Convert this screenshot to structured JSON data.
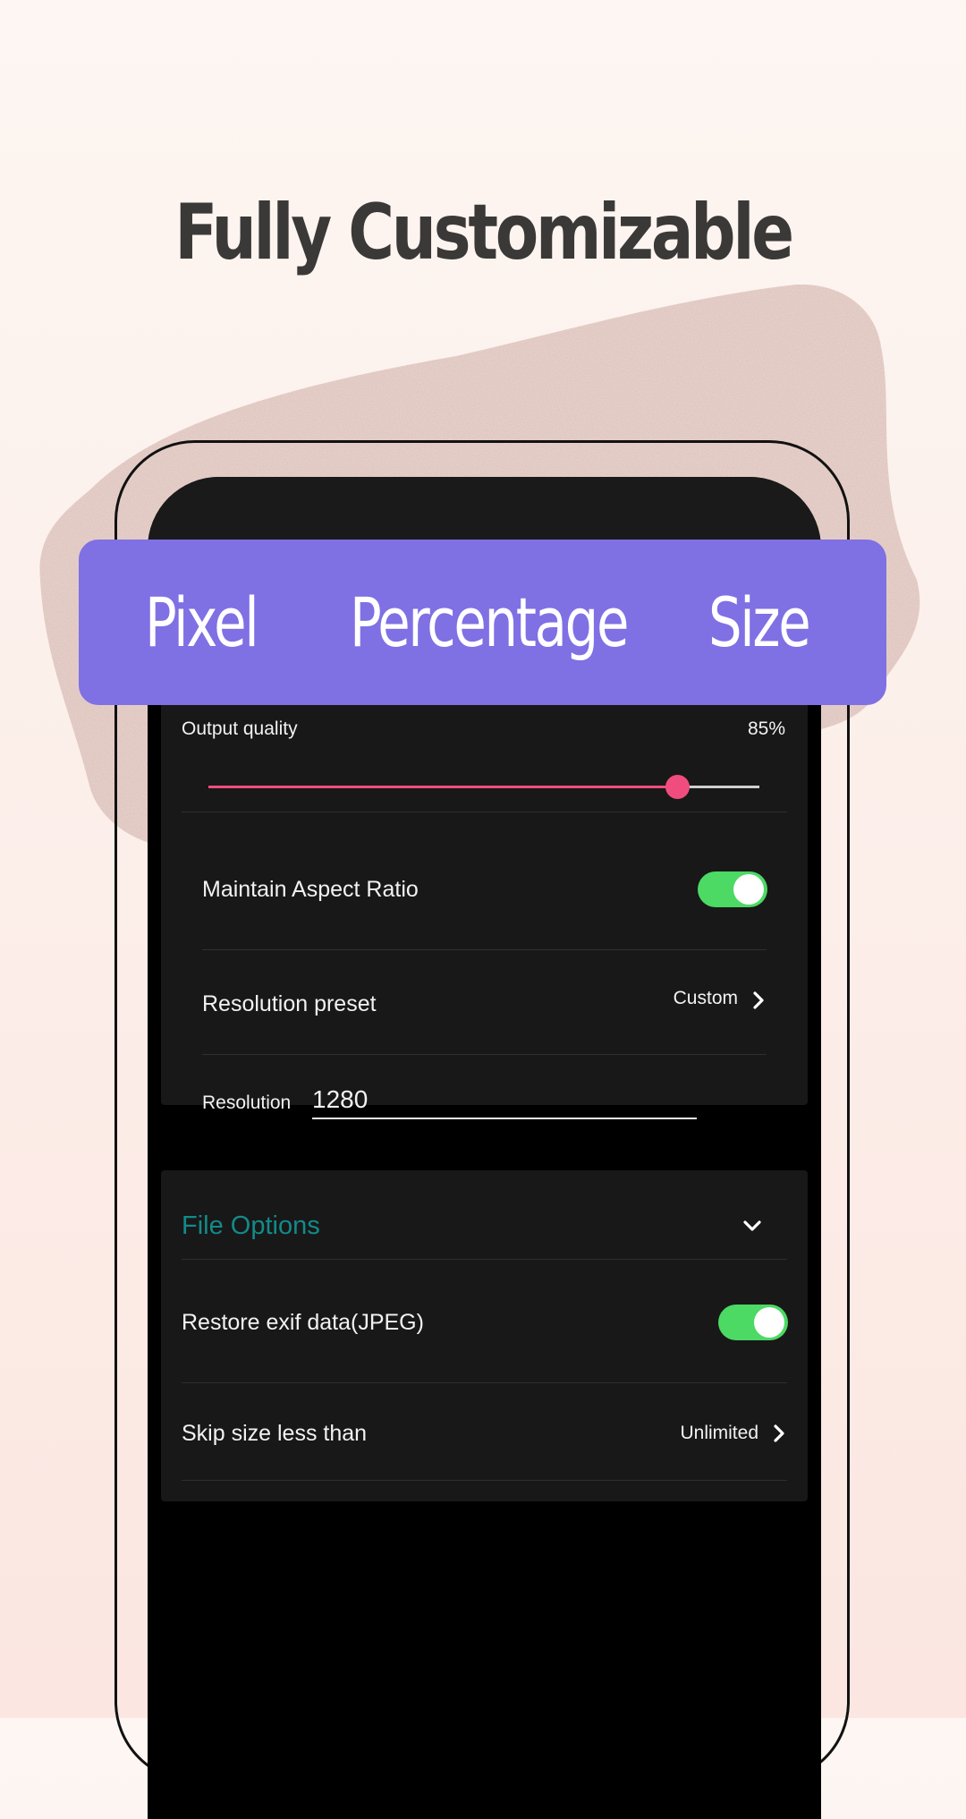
{
  "headline": "Fully Customizable",
  "banner": {
    "options": [
      "Pixel",
      "Percentage",
      "Size"
    ]
  },
  "settings": {
    "output_quality": {
      "label": "Output quality",
      "value_text": "85%",
      "value": 0.85
    },
    "maintain_aspect_ratio": {
      "label": "Maintain Aspect Ratio",
      "on": true
    },
    "resolution_preset": {
      "label": "Resolution preset",
      "value": "Custom"
    },
    "resolution": {
      "label": "Resolution",
      "value": "1280"
    }
  },
  "file_options": {
    "title": "File Options",
    "restore_exif": {
      "label": "Restore exif data(JPEG)",
      "on": true
    },
    "skip_size": {
      "label": "Skip size less than",
      "value": "Unlimited"
    }
  },
  "colors": {
    "banner": "#7f70e4",
    "accent": "#f04d7e",
    "toggle_on": "#4cd964",
    "section_title": "#138a8a",
    "headline": "#3b3838"
  },
  "icons": [
    "chevron-right-icon",
    "chevron-down-icon"
  ]
}
